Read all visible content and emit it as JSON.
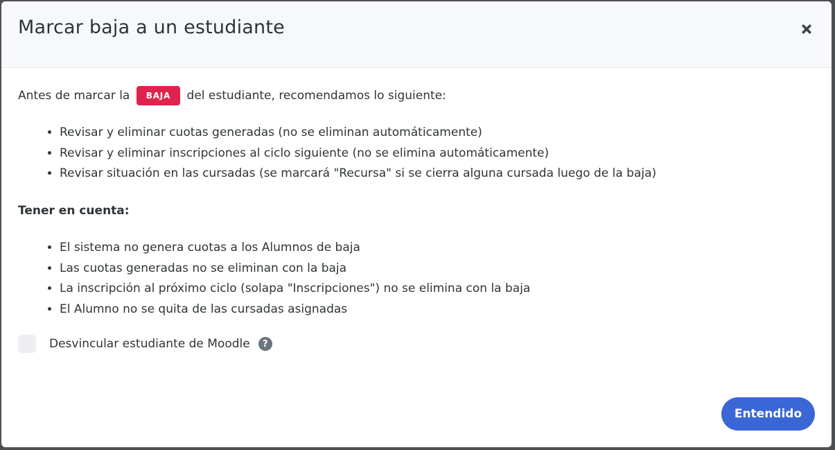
{
  "modal": {
    "title": "Marcar baja a un estudiante",
    "close_icon": "close-icon"
  },
  "body": {
    "intro_before": "Antes de marcar la",
    "badge": "BAJA",
    "intro_after": "del estudiante, recomendamos lo siguiente:",
    "recommendations": [
      "Revisar y eliminar cuotas generadas (no se eliminan automáticamente)",
      "Revisar y eliminar inscripciones al ciclo siguiente (no se elimina automáticamente)",
      "Revisar situación en las cursadas (se marcará \"Recursa\" si se cierra alguna cursada luego de la baja)"
    ],
    "notes_title": "Tener en cuenta:",
    "notes": [
      "El sistema no genera cuotas a los Alumnos de baja",
      "Las cuotas generadas no se eliminan con la baja",
      "La inscripción al próximo ciclo (solapa \"Inscripciones\") no se elimina con la baja",
      "El Alumno no se quita de las cursadas asignadas"
    ],
    "checkbox_label": "Desvincular estudiante de Moodle",
    "checkbox_checked": false,
    "help_icon": "?"
  },
  "footer": {
    "ok_label": "Entendido"
  },
  "colors": {
    "badge": "#e0234e",
    "primary_button": "#3b66d6",
    "header_bg": "#f7f8fa"
  }
}
